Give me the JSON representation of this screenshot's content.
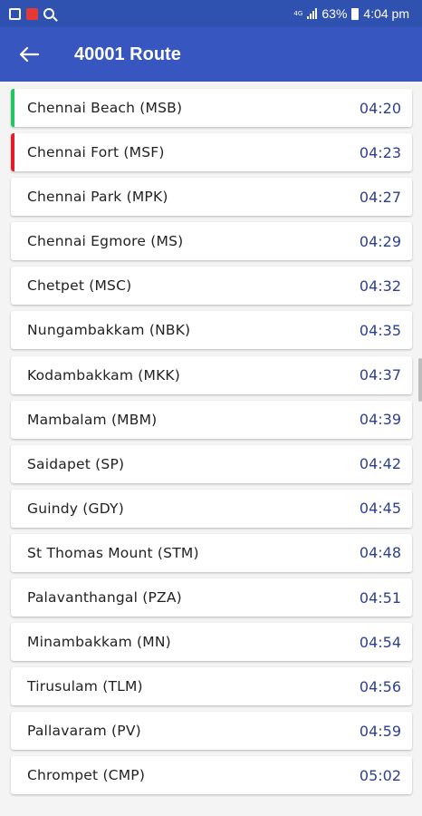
{
  "status_bar": {
    "network": "4G",
    "battery": "63%",
    "time": "4:04 pm"
  },
  "app_bar": {
    "back_icon": "arrow-back-icon",
    "title": "40001 Route"
  },
  "colors": {
    "primary": "#3756c0",
    "status_bar": "#2f51b0",
    "time_text": "#2d3f8f",
    "start_accent": "#22c55e",
    "current_accent": "#e11d2a"
  },
  "stations": [
    {
      "name": "Chennai Beach (MSB)",
      "time": "04:20",
      "accent": "#22c55e"
    },
    {
      "name": "Chennai Fort (MSF)",
      "time": "04:23",
      "accent": "#e11d2a"
    },
    {
      "name": "Chennai Park (MPK)",
      "time": "04:27",
      "accent": ""
    },
    {
      "name": "Chennai Egmore (MS)",
      "time": "04:29",
      "accent": ""
    },
    {
      "name": "Chetpet (MSC)",
      "time": "04:32",
      "accent": ""
    },
    {
      "name": "Nungambakkam (NBK)",
      "time": "04:35",
      "accent": ""
    },
    {
      "name": "Kodambakkam (MKK)",
      "time": "04:37",
      "accent": ""
    },
    {
      "name": "Mambalam (MBM)",
      "time": "04:39",
      "accent": ""
    },
    {
      "name": "Saidapet (SP)",
      "time": "04:42",
      "accent": ""
    },
    {
      "name": "Guindy (GDY)",
      "time": "04:45",
      "accent": ""
    },
    {
      "name": "St Thomas Mount (STM)",
      "time": "04:48",
      "accent": ""
    },
    {
      "name": "Palavanthangal (PZA)",
      "time": "04:51",
      "accent": ""
    },
    {
      "name": "Minambakkam (MN)",
      "time": "04:54",
      "accent": ""
    },
    {
      "name": "Tirusulam (TLM)",
      "time": "04:56",
      "accent": ""
    },
    {
      "name": "Pallavaram (PV)",
      "time": "04:59",
      "accent": ""
    },
    {
      "name": "Chrompet (CMP)",
      "time": "05:02",
      "accent": ""
    }
  ]
}
